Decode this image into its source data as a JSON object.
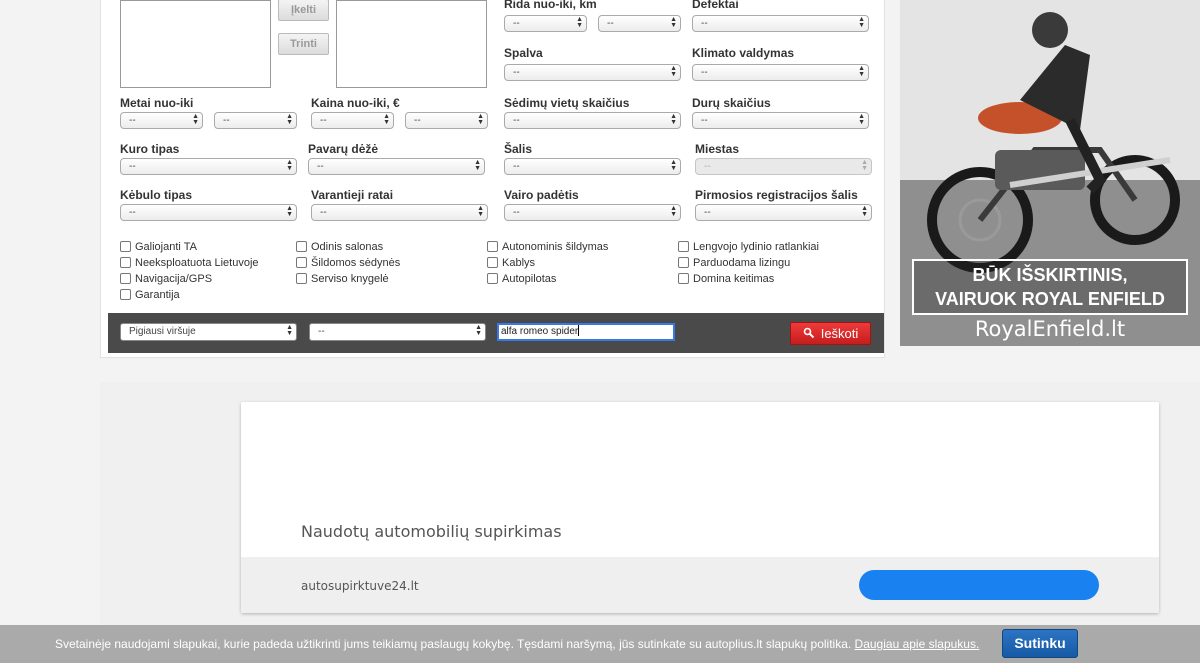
{
  "form": {
    "photo_upload_button": "Įkelti",
    "photo_delete_button": "Trinti",
    "labels": {
      "mileage": "Rida nuo-iki, km",
      "defects": "Defektai",
      "color": "Spalva",
      "climate": "Klimato valdymas",
      "year": "Metai nuo-iki",
      "price": "Kaina nuo-iki, €",
      "seats": "Sėdimų vietų skaičius",
      "doors": "Durų skaičius",
      "fuel": "Kuro tipas",
      "gearbox": "Pavarų dėžė",
      "country": "Šalis",
      "city": "Miestas",
      "body": "Kėbulo tipas",
      "drive": "Varantieji ratai",
      "steering": "Vairo padėtis",
      "first_reg_country": "Pirmosios registracijos šalis"
    },
    "empty_option": "--",
    "checkboxes": {
      "col1": [
        "Galiojanti TA",
        "Neeksploatuota Lietuvoje",
        "Navigacija/GPS",
        "Garantija"
      ],
      "col2": [
        "Odinis salonas",
        "Šildomos sėdynės",
        "Serviso knygelė"
      ],
      "col3": [
        "Autonominis šildymas",
        "Kablys",
        "Autopilotas"
      ],
      "col4": [
        "Lengvojo lydinio ratlankiai",
        "Parduodama lizingu",
        "Domina keitimas"
      ]
    }
  },
  "search_bar": {
    "sort_value": "Pigiausi viršuje",
    "second_select_value": "--",
    "query": "alfa romeo spider",
    "search_button": "Ieškoti"
  },
  "ad": {
    "line1": "BŪK IŠSKIRTINIS,",
    "line2": "VAIRUOK ROYAL ENFIELD",
    "site": "RoyalEnfield.lt"
  },
  "card": {
    "title": "Naudotų automobilių supirkimas",
    "link": "autosupirktuve24.lt",
    "button_color": "#1a81f0"
  },
  "cookie_bar": {
    "text": "Svetainėje naudojami slapukai, kurie padeda užtikrinti jums teikiamų paslaugų kokybę. Tęsdami naršymą, jūs sutinkate su autoplius.lt slapukų politika.",
    "link": "Daugiau apie slapukus.",
    "accept_button": "Sutinku"
  },
  "colors": {
    "search_button": "#d92a2a",
    "search_bar_bg": "#4a4a4a",
    "cookie_button": "#1f66b3"
  }
}
